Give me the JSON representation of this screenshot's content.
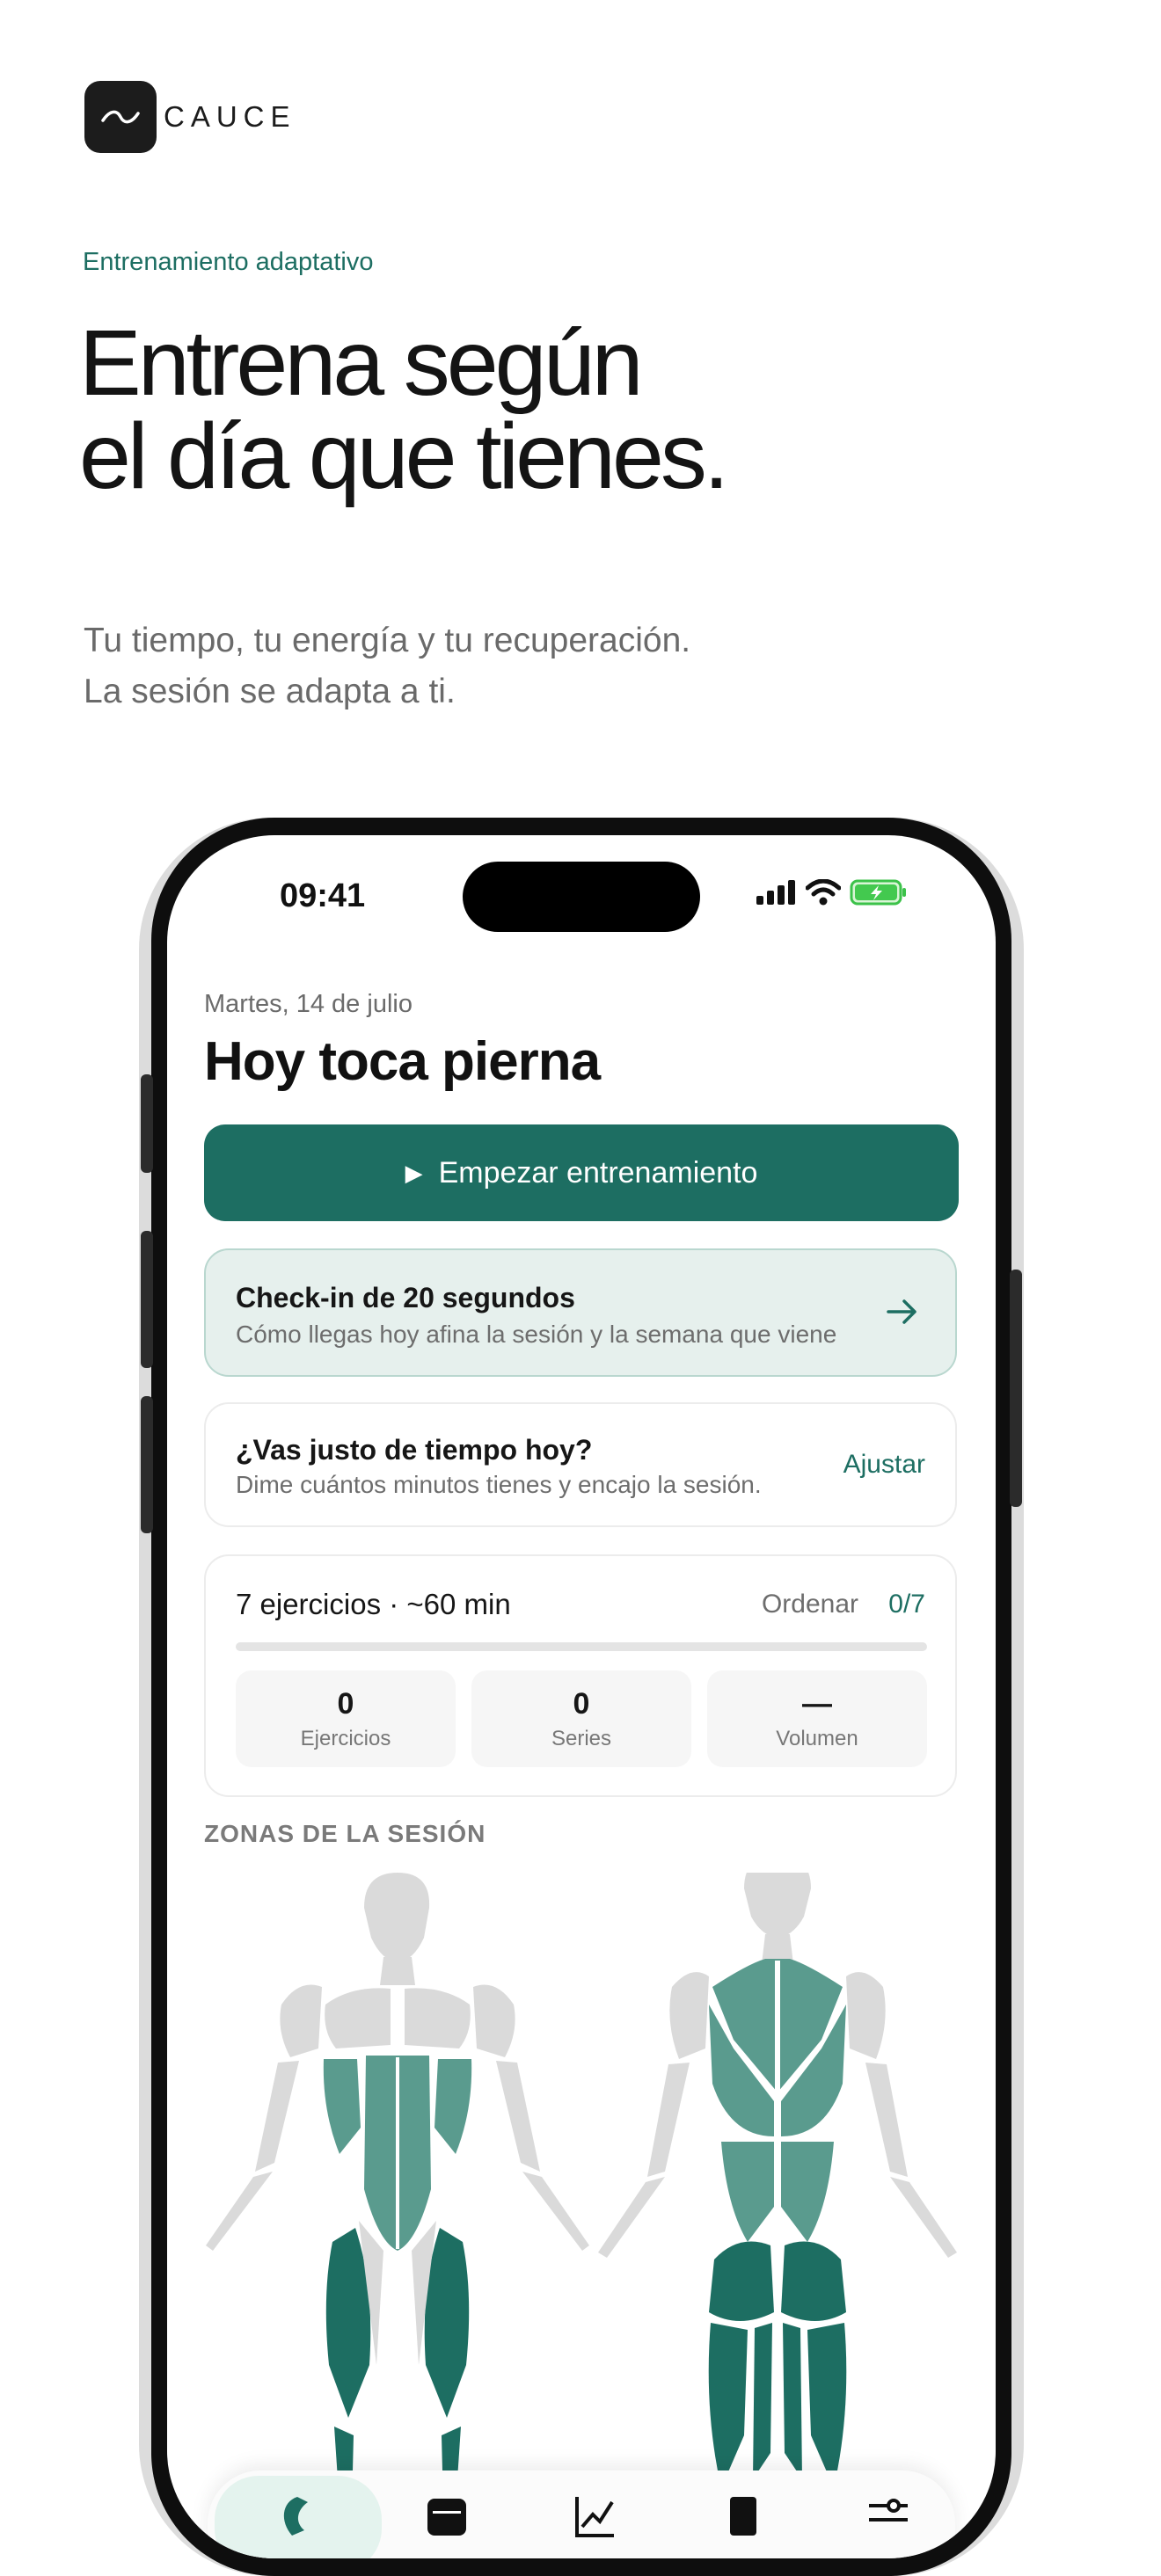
{
  "brand": {
    "name": "CAUCE",
    "logo_icon": "wave-icon"
  },
  "hero": {
    "eyebrow": "Entrenamiento adaptativo",
    "headline_line1": "Entrena según",
    "headline_line2": "el día que tienes.",
    "sub_line1": "Tu tiempo, tu energía y tu recuperación.",
    "sub_line2": "La sesión se adapta a ti."
  },
  "status_bar": {
    "time": "09:41",
    "icons": [
      "cellular-icon",
      "wifi-icon",
      "battery-charging-icon"
    ]
  },
  "screen": {
    "date": "Martes, 14 de julio",
    "title": "Hoy toca pierna",
    "start_button": {
      "label": "Empezar entrenamiento",
      "icon": "play-icon"
    },
    "checkin": {
      "title": "Check-in de 20 segundos",
      "subtitle": "Cómo llegas hoy afina la sesión y la semana que viene",
      "icon": "arrow-right-icon"
    },
    "time_card": {
      "title": "¿Vas justo de tiempo hoy?",
      "subtitle": "Dime cuántos minutos tienes y encajo la sesión.",
      "action": "Ajustar"
    },
    "workout": {
      "summary": "7 ejercicios · ~60 min",
      "sort_label": "Ordenar",
      "progress_label": "0/7",
      "progress_fraction": 0,
      "stats": [
        {
          "value": "0",
          "label": "Ejercicios"
        },
        {
          "value": "0",
          "label": "Series"
        },
        {
          "value": "—",
          "label": "Volumen"
        }
      ]
    },
    "zones_label": "ZONAS DE LA SESIÓN",
    "tabs": [
      "home-icon",
      "calendar-icon",
      "chart-icon",
      "book-icon",
      "sliders-icon"
    ]
  },
  "colors": {
    "accent": "#1d6e62",
    "accent_mid": "#5a9b8e",
    "muscle_idle": "#dadada",
    "checkin_bg": "#e6f0ed"
  }
}
